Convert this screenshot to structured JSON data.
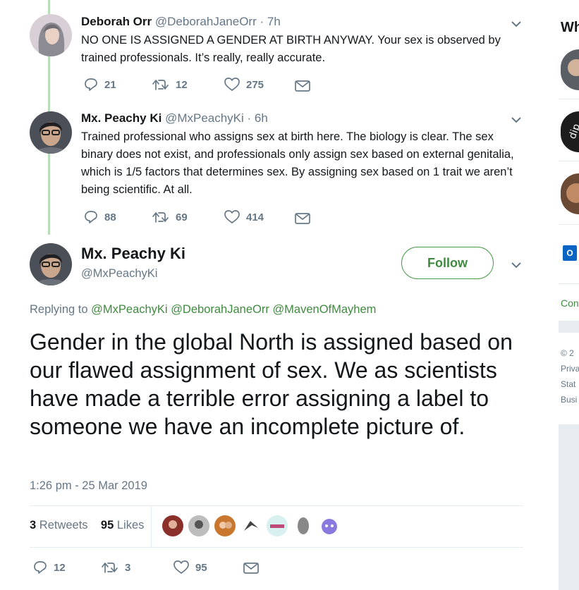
{
  "thread": [
    {
      "name": "Deborah Orr",
      "handle": "@DeborahJaneOrr",
      "dot": " · ",
      "time": "7h",
      "text": "NO ONE IS ASSIGNED A GENDER AT BIRTH ANYWAY. Your sex is observed by trained professionals. It’s really, really accurate.",
      "replies": "21",
      "retweets": "12",
      "likes": "275"
    },
    {
      "name": "Mx. Peachy Ki",
      "handle": "@MxPeachyKi",
      "dot": " · ",
      "time": "6h",
      "text": "Trained professional who assigns sex at birth here. The biology is clear. The sex binary does not exist, and professionals only assign sex based on external genitalia, which is 1/5 factors that determines sex. By assigning sex based on 1 trait we aren’t being scientific. At all.",
      "replies": "88",
      "retweets": "69",
      "likes": "414"
    }
  ],
  "main": {
    "name": "Mx. Peachy Ki",
    "handle": "@MxPeachyKi",
    "follow_label": "Follow",
    "replying_prefix": "Replying to ",
    "replying_to": [
      "@MxPeachyKi",
      "@DeborahJaneOrr",
      "@MavenOfMayhem"
    ],
    "text": "Gender in the global North is assigned based on our flawed assignment of sex. We as scientists have made a terrible error assigning a label to someone we have an incomplete picture of.",
    "timestamp": "1:26 pm - 25 Mar 2019",
    "retweet_count": "3",
    "retweet_label": "Retweets",
    "like_count": "95",
    "like_label": "Likes",
    "action_replies": "12",
    "action_retweets": "3",
    "action_likes": "95"
  },
  "sidebar": {
    "title": "Wh",
    "link": "Con",
    "footer": [
      "© 2",
      "Priva",
      "Stat",
      "Busi"
    ]
  },
  "colors": {
    "accent": "#3f8a3f",
    "thread_line": "#b9dcb9",
    "muted": "#657786"
  },
  "icons": [
    "reply-icon",
    "retweet-icon",
    "like-icon",
    "dm-icon",
    "chevron-down-icon"
  ]
}
